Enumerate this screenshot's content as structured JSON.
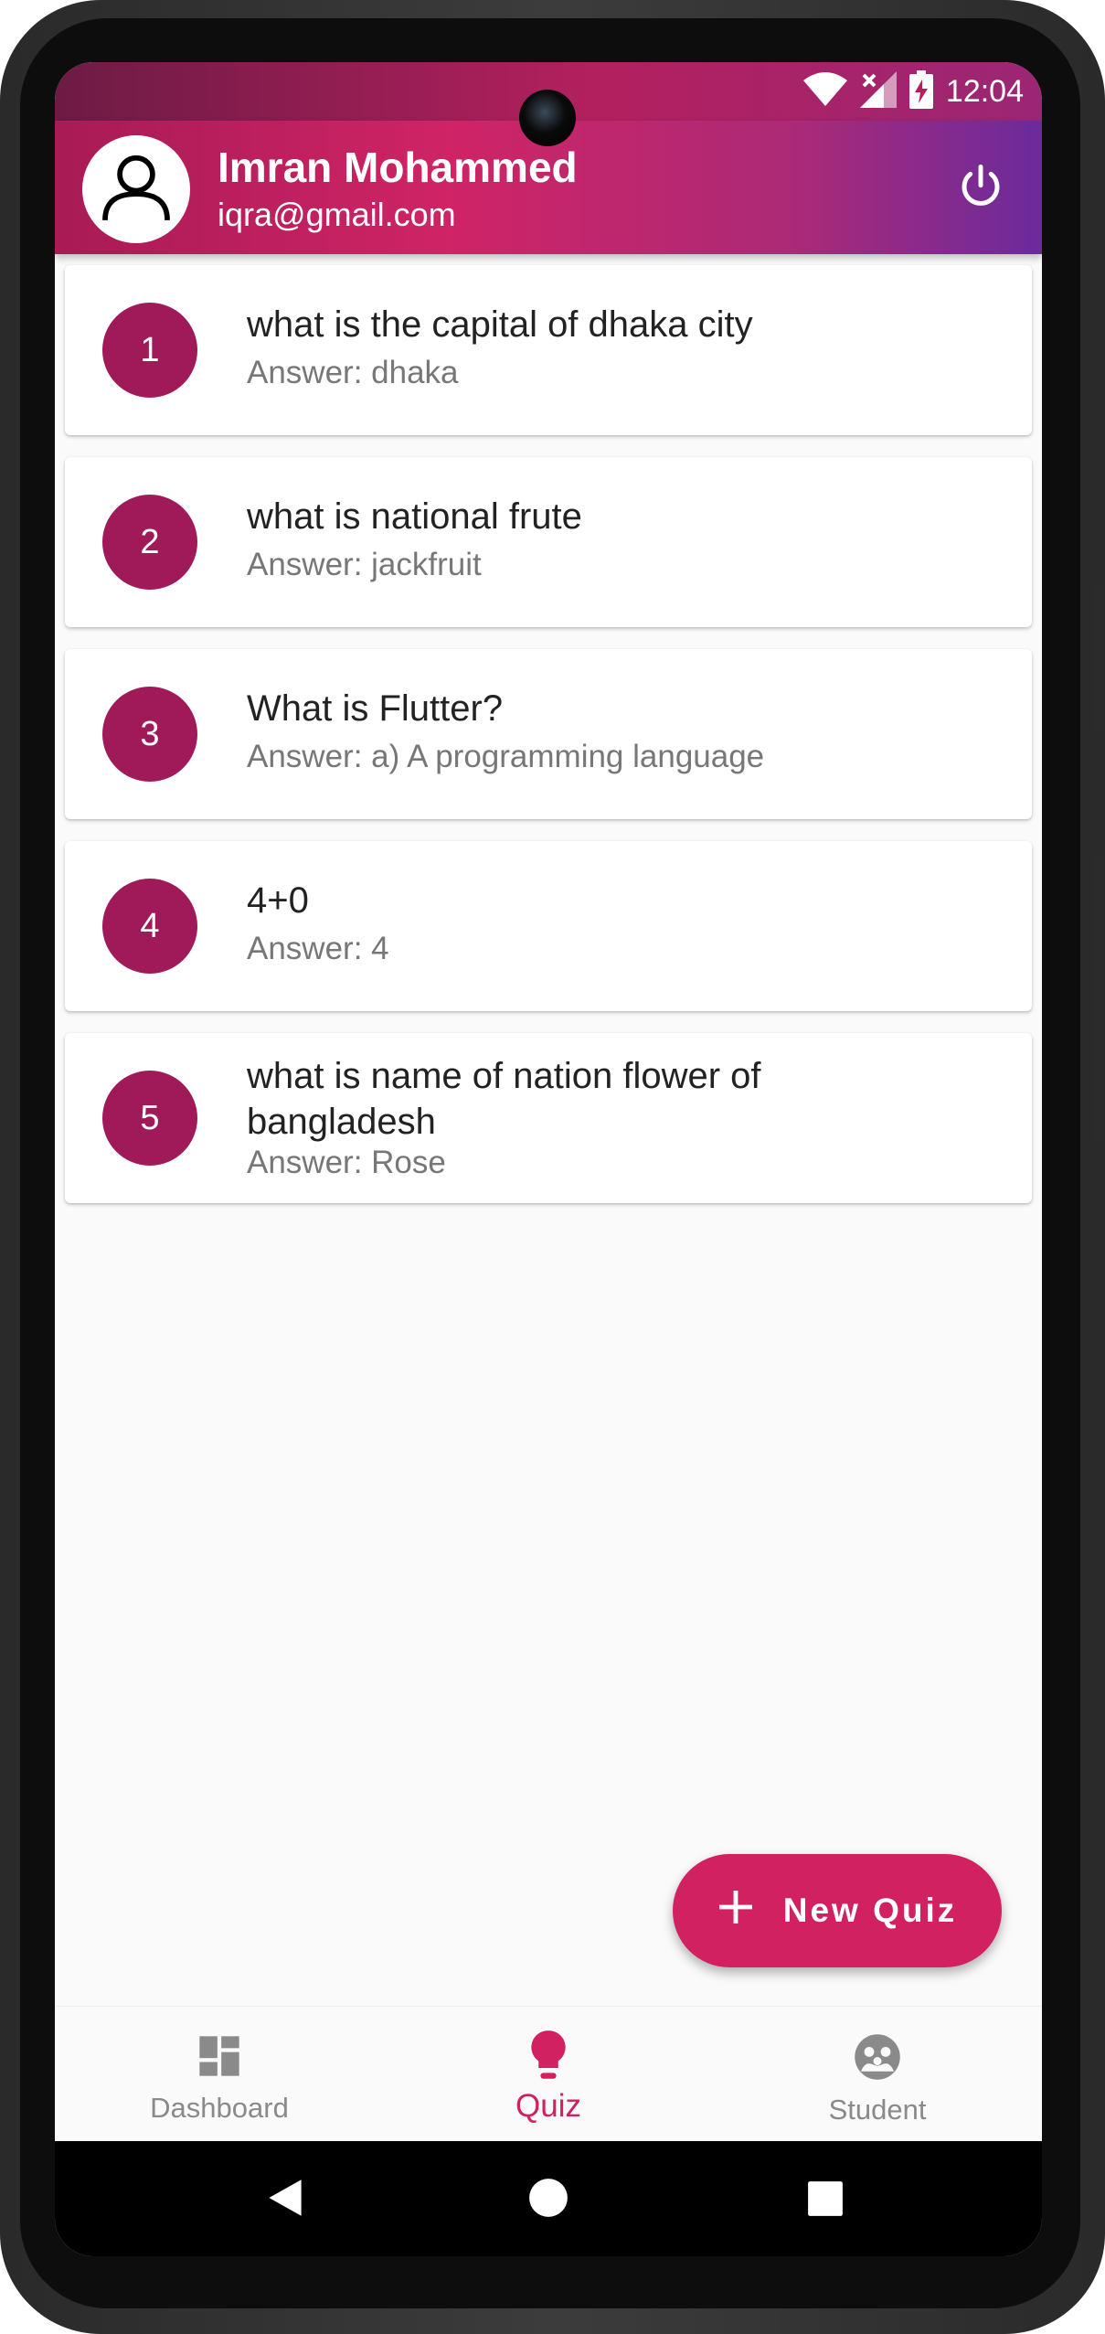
{
  "status_bar": {
    "time": "12:04"
  },
  "header": {
    "user_name": "Imran Mohammed",
    "user_email": "iqra@gmail.com",
    "avatar_icon": "person-icon",
    "logout_icon": "power-icon"
  },
  "quizzes": [
    {
      "number": "1",
      "question": "what is the capital of dhaka city",
      "answer": "Answer: dhaka"
    },
    {
      "number": "2",
      "question": "what is national frute",
      "answer": "Answer: jackfruit"
    },
    {
      "number": "3",
      "question": "What is Flutter?",
      "answer": "Answer: a) A programming language"
    },
    {
      "number": "4",
      "question": "4+0",
      "answer": "Answer: 4"
    },
    {
      "number": "5",
      "question": "what is name of nation flower of bangladesh",
      "answer": "Answer: Rose"
    }
  ],
  "fab": {
    "label": "New Quiz",
    "icon": "plus-icon"
  },
  "bottom_nav": [
    {
      "label": "Dashboard",
      "icon": "dashboard-icon",
      "active": false
    },
    {
      "label": "Quiz",
      "icon": "lightbulb-icon",
      "active": true
    },
    {
      "label": "Student",
      "icon": "student-icon",
      "active": false
    }
  ],
  "colors": {
    "primary": "#d12161",
    "number_badge": "#a01a5a",
    "inactive": "#8a8a8a"
  }
}
